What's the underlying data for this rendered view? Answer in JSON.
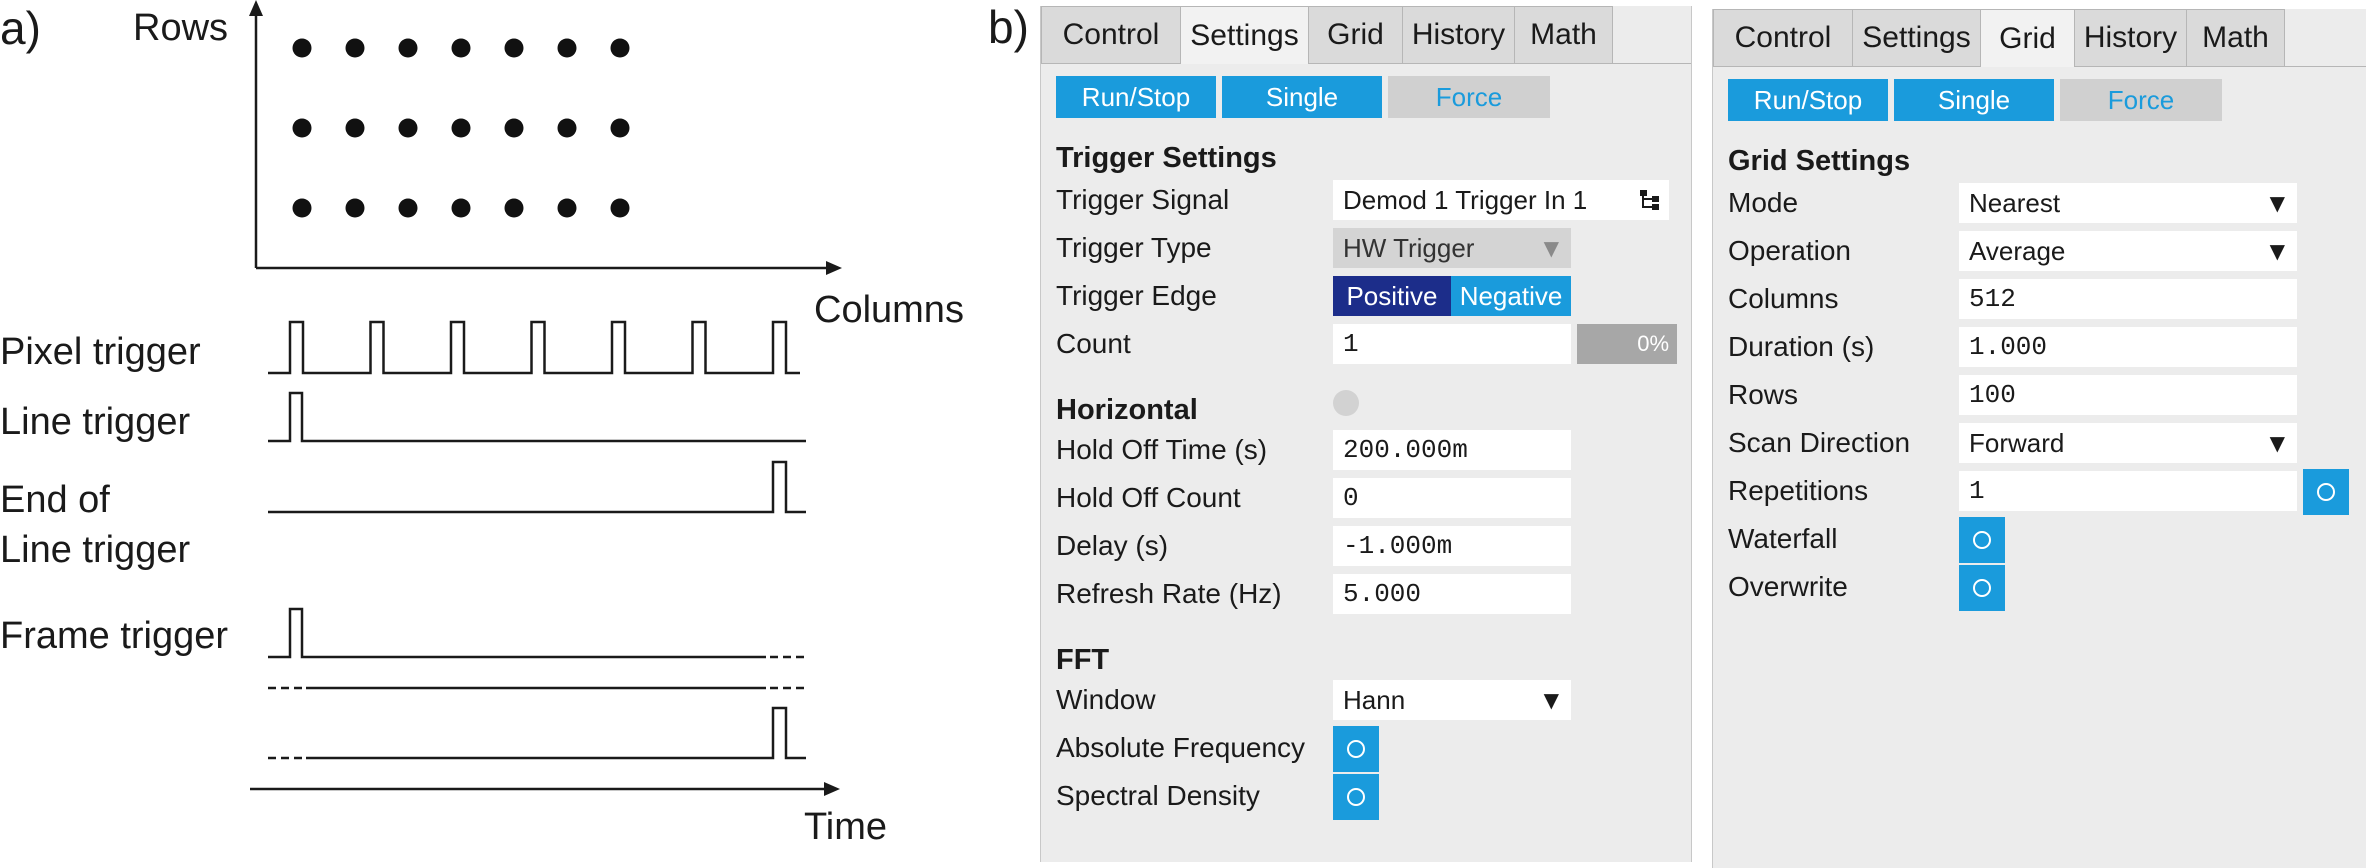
{
  "diagram": {
    "panel_label": "a)",
    "axis_rows": "Rows",
    "axis_columns": "Columns",
    "axis_time": "Time",
    "pixel_trigger": "Pixel trigger",
    "line_trigger": "Line trigger",
    "end_of_line_1": "End of",
    "end_of_line_2": "Line trigger",
    "frame_trigger": "Frame  trigger",
    "grid_rows": 3,
    "grid_cols": 7
  },
  "panel_b": {
    "label": "b)",
    "tabs": [
      {
        "label": "Control",
        "active": false
      },
      {
        "label": "Settings",
        "active": true
      },
      {
        "label": "Grid",
        "active": false
      },
      {
        "label": "History",
        "active": false
      },
      {
        "label": "Math",
        "active": false
      }
    ],
    "buttons": {
      "run_stop": "Run/Stop",
      "single": "Single",
      "force": "Force"
    },
    "trigger_settings": {
      "title": "Trigger Settings",
      "signal_label": "Trigger Signal",
      "signal_value": "Demod 1 Trigger In 1",
      "type_label": "Trigger Type",
      "type_value": "HW Trigger",
      "edge_label": "Trigger Edge",
      "edge_positive": "Positive",
      "edge_negative": "Negative",
      "count_label": "Count",
      "count_value": "1",
      "progress_text": "0%",
      "progress": 0
    },
    "horizontal": {
      "title": "Horizontal",
      "hold_off_time_label": "Hold Off Time (s)",
      "hold_off_time_value": "200.000m",
      "hold_off_count_label": "Hold Off Count",
      "hold_off_count_value": "0",
      "delay_label": "Delay (s)",
      "delay_value": "-1.000m",
      "refresh_label": "Refresh Rate (Hz)",
      "refresh_value": "5.000"
    },
    "fft": {
      "title": "FFT",
      "window_label": "Window",
      "window_value": "Hann",
      "abs_freq_label": "Absolute Frequency",
      "spectral_label": "Spectral Density"
    }
  },
  "panel_c": {
    "tabs": [
      {
        "label": "Control",
        "active": false
      },
      {
        "label": "Settings",
        "active": false
      },
      {
        "label": "Grid",
        "active": true
      },
      {
        "label": "History",
        "active": false
      },
      {
        "label": "Math",
        "active": false
      }
    ],
    "buttons": {
      "run_stop": "Run/Stop",
      "single": "Single",
      "force": "Force"
    },
    "grid_settings": {
      "title": "Grid Settings",
      "mode_label": "Mode",
      "mode_value": "Nearest",
      "operation_label": "Operation",
      "operation_value": "Average",
      "columns_label": "Columns",
      "columns_value": "512",
      "duration_label": "Duration (s)",
      "duration_value": "1.000",
      "rows_label": "Rows",
      "rows_value": "100",
      "scan_label": "Scan Direction",
      "scan_value": "Forward",
      "repetitions_label": "Repetitions",
      "repetitions_value": "1",
      "waterfall_label": "Waterfall",
      "overwrite_label": "Overwrite"
    }
  },
  "colors": {
    "accent": "#1a9bdc",
    "accent_dark": "#1c2d8a",
    "panel_bg": "#ececec"
  }
}
